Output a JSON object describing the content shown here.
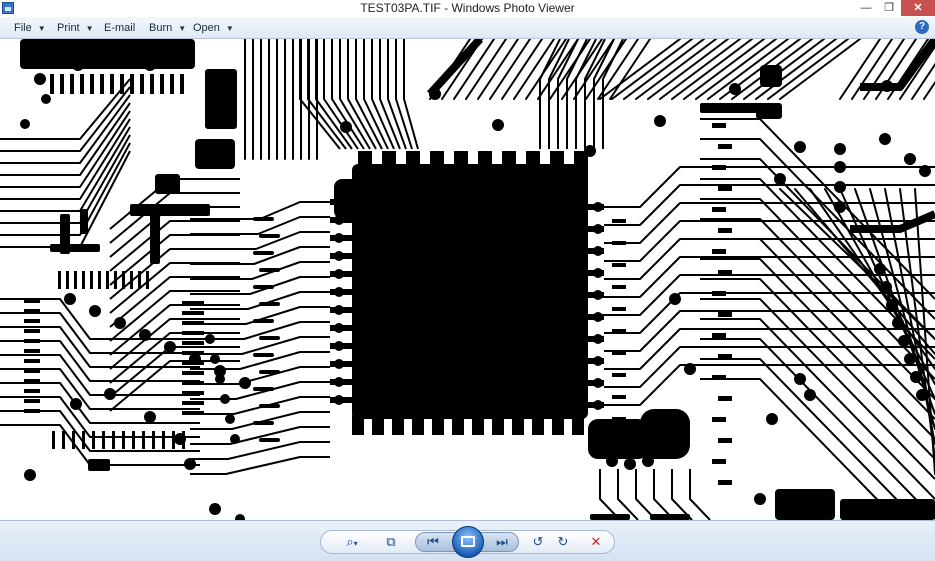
{
  "window": {
    "title": "TEST03PA.TIF - Windows Photo Viewer",
    "minimize_glyph": "—",
    "maximize_glyph": "❐",
    "close_glyph": "✕"
  },
  "menu": {
    "file": "File",
    "print": "Print",
    "email": "E-mail",
    "burn": "Burn",
    "open": "Open",
    "dropdown_glyph": "▼",
    "help_glyph": "?"
  },
  "image": {
    "description": "",
    "ink_color": "#000000",
    "paper_color": "#ffffff"
  },
  "toolbar": {
    "zoom_glyph": "⌕",
    "zoom_caret": "▾",
    "actual_size_glyph": "⧉",
    "previous_glyph": "⏮",
    "next_glyph": "⏭",
    "rotate_ccw_glyph": "↺",
    "rotate_cw_glyph": "↻",
    "delete_glyph": "✕"
  },
  "icons": {
    "app": "photo-viewer-icon",
    "help": "help-icon",
    "zoom": "magnifier-icon",
    "actual_size": "actual-size-icon",
    "previous": "skip-previous-icon",
    "slideshow": "slideshow-icon",
    "next": "skip-next-icon",
    "rotate_ccw": "rotate-counterclockwise-icon",
    "rotate_cw": "rotate-clockwise-icon",
    "delete": "delete-icon"
  },
  "colors": {
    "accent": "#1b5fb8",
    "close_button": "#c75050",
    "delete": "#c62828"
  }
}
